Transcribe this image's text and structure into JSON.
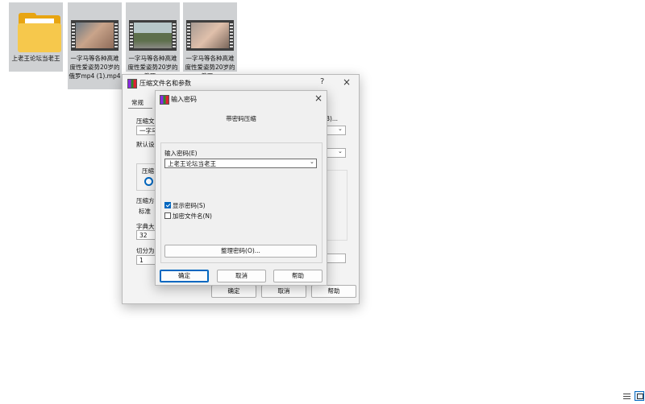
{
  "desktop": {
    "items": [
      {
        "label": "上老王论坛当老王",
        "type": "folder"
      },
      {
        "label": "一字马等各种高难度性爱姿势20岁的俄罗mp4 (1).mp4",
        "type": "video"
      },
      {
        "label": "一字马等各种高难度性爱姿势20岁的俄罗…",
        "type": "video"
      },
      {
        "label": "一字马等各种高难度性爱姿势20岁的俄罗…",
        "type": "video"
      }
    ]
  },
  "archive_dialog": {
    "title": "压缩文件名和参数",
    "help_glyph": "?",
    "close_glyph": "×",
    "tab_general": "常规",
    "label_archive": "压缩文",
    "archive_value": "一字马",
    "browse_label": "(B)...",
    "label_default": "默认设",
    "label_format": "压缩",
    "label_method": "压缩方",
    "method_value": "标准",
    "label_dict": "字典大",
    "dict_value": "32",
    "label_split": "切分为",
    "split_value": "1",
    "ok": "确定",
    "cancel": "取消",
    "help": "帮助"
  },
  "password_dialog": {
    "title": "输入密码",
    "heading": "带密码压缩",
    "label_password": "输入密码(E)",
    "password_value": "上老王论坛当老王",
    "show_password": "显示密码(S)",
    "show_password_checked": true,
    "encrypt_names": "加密文件名(N)",
    "encrypt_names_checked": false,
    "organize": "整理密码(O)...",
    "ok": "确定",
    "cancel": "取消",
    "help": "帮助",
    "close_glyph": "×"
  },
  "taskbar": {
    "list_icon": "list-view-icon",
    "window_icon": "window-view-icon"
  },
  "colors": {
    "accent": "#0067c0",
    "folder": "#f6c84c",
    "selection": "#cfd1d3"
  }
}
